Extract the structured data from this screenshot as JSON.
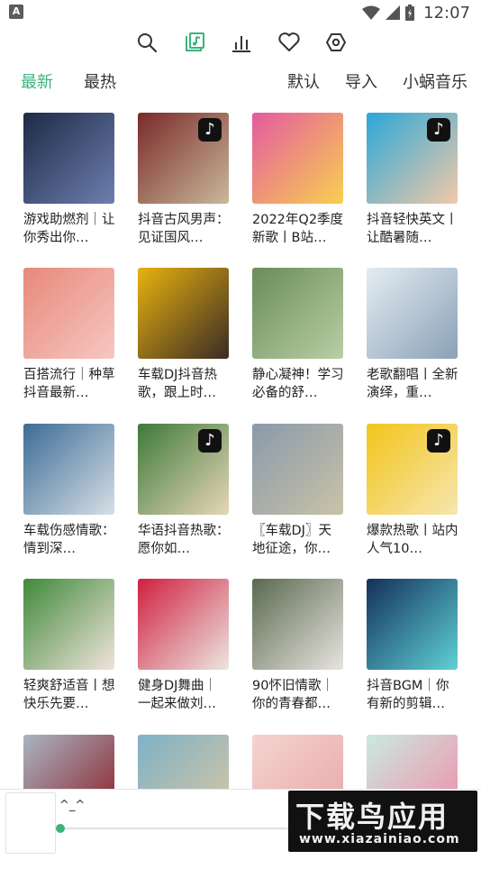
{
  "status": {
    "left_icon_letter": "A",
    "time": "12:07"
  },
  "toolbar": {
    "icons": [
      "search-icon",
      "music-note-icon",
      "chart-icon",
      "heart-icon",
      "settings-hex-icon"
    ],
    "active": "music-note-icon",
    "accent_color": "#3fb17e"
  },
  "tabs": {
    "left": [
      {
        "label": "最新",
        "active": true
      },
      {
        "label": "最热",
        "active": false
      }
    ],
    "right": [
      {
        "label": "默认"
      },
      {
        "label": "导入"
      },
      {
        "label": "小蜗音乐"
      }
    ]
  },
  "playlists": [
    {
      "title": "游戏助燃剂｜让你秀出你…",
      "c1": "#1d2a45",
      "c2": "#6d7fb0"
    },
    {
      "title": "抖音古风男声：见证国风…",
      "c1": "#7a2a2a",
      "c2": "#c9b89a",
      "tiktok": true
    },
    {
      "title": "2022年Q2季度新歌丨B站…",
      "c1": "#e55aa0",
      "c2": "#f7d050"
    },
    {
      "title": "抖音轻快英文丨让酷暑随…",
      "c1": "#2aa7d8",
      "c2": "#f2c9a8",
      "tiktok": true
    },
    {
      "title": "百搭流行｜种草抖音最新…",
      "c1": "#e7897a",
      "c2": "#f6c7c2"
    },
    {
      "title": "车载DJ抖音热歌，跟上时…",
      "c1": "#e8b20e",
      "c2": "#3a2b25"
    },
    {
      "title": "静心凝神！学习必备的舒…",
      "c1": "#6a8c5a",
      "c2": "#b9cfa3"
    },
    {
      "title": "老歌翻唱丨全新演绎，重…",
      "c1": "#e4ecf2",
      "c2": "#8aa1b7"
    },
    {
      "title": "车载伤感情歌：情到深…",
      "c1": "#3c6c96",
      "c2": "#d7dfe6"
    },
    {
      "title": "华语抖音热歌：愿你如…",
      "c1": "#3e7a3a",
      "c2": "#e6d6b8",
      "tiktok": true
    },
    {
      "title": "〖车载DJ〗天地征途，你…",
      "c1": "#8a9aaa",
      "c2": "#c9c2a8"
    },
    {
      "title": "爆款热歌丨站内人气10…",
      "c1": "#f2c51a",
      "c2": "#f7e6b0",
      "tiktok": true
    },
    {
      "title": "轻爽舒适音丨想快乐先要…",
      "c1": "#3f8a3a",
      "c2": "#f1e3dc"
    },
    {
      "title": "健身DJ舞曲｜一起来做刘…",
      "c1": "#d02040",
      "c2": "#ece6e0"
    },
    {
      "title": "90怀旧情歌｜你的青春都…",
      "c1": "#5a6a50",
      "c2": "#e8e4df"
    },
    {
      "title": "抖音BGM｜你有新的剪辑…",
      "c1": "#14305a",
      "c2": "#5fd1d6"
    },
    {
      "title": "",
      "c1": "#a9b6c2",
      "c2": "#8a1a24"
    },
    {
      "title": "",
      "c1": "#7fb1c8",
      "c2": "#d9c7a2"
    },
    {
      "title": "",
      "c1": "#f4d3d0",
      "c2": "#e8a7a7"
    },
    {
      "title": "",
      "c1": "#c9eae0",
      "c2": "#f28aa8"
    }
  ],
  "player": {
    "text": "^_^"
  },
  "watermark": {
    "main": "下载鸟应用",
    "sub": "www.xiazainiao.com"
  }
}
